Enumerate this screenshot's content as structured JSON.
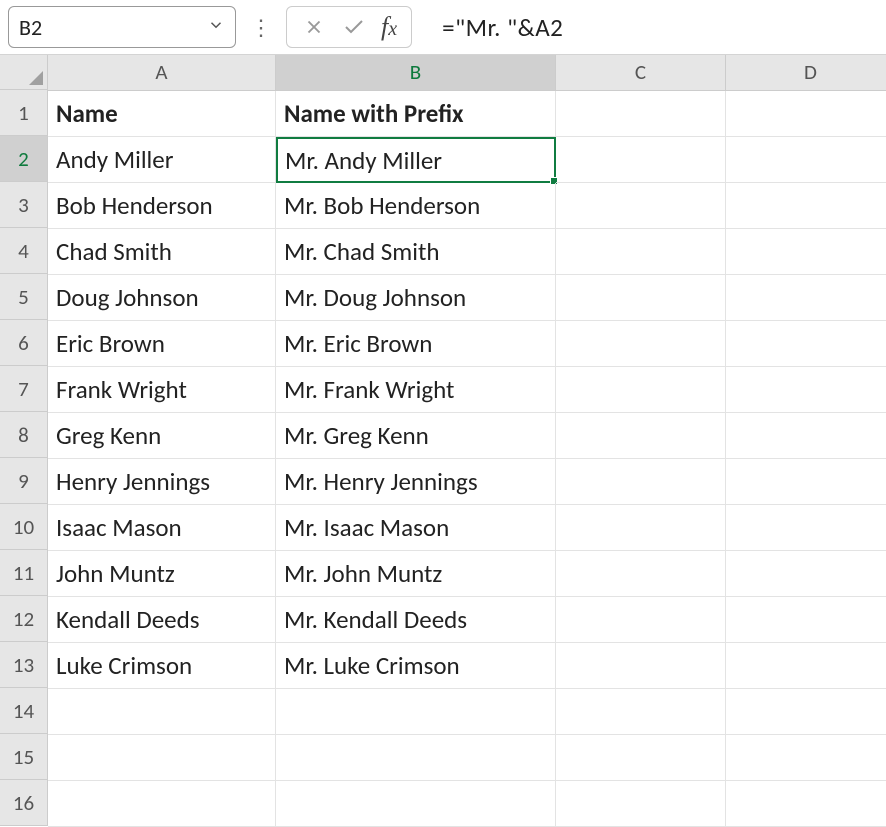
{
  "name_box": "B2",
  "formula": "=\"Mr. \"&A2",
  "columns": [
    "A",
    "B",
    "C",
    "D"
  ],
  "active_col": "B",
  "active_row": 2,
  "last_row": 16,
  "headers": {
    "A": "Name",
    "B": "Name with Prefix"
  },
  "table": [
    {
      "A": "Andy Miller",
      "B": "Mr. Andy Miller"
    },
    {
      "A": "Bob Henderson",
      "B": "Mr. Bob Henderson"
    },
    {
      "A": "Chad Smith",
      "B": "Mr. Chad Smith"
    },
    {
      "A": "Doug Johnson",
      "B": "Mr. Doug Johnson"
    },
    {
      "A": "Eric Brown",
      "B": "Mr. Eric Brown"
    },
    {
      "A": "Frank Wright",
      "B": "Mr. Frank Wright"
    },
    {
      "A": "Greg Kenn",
      "B": "Mr. Greg Kenn"
    },
    {
      "A": "Henry Jennings",
      "B": "Mr. Henry Jennings"
    },
    {
      "A": "Isaac Mason",
      "B": "Mr. Isaac Mason"
    },
    {
      "A": "John Muntz",
      "B": "Mr. John Muntz"
    },
    {
      "A": "Kendall Deeds",
      "B": "Mr. Kendall Deeds"
    },
    {
      "A": "Luke Crimson",
      "B": "Mr. Luke Crimson"
    }
  ]
}
